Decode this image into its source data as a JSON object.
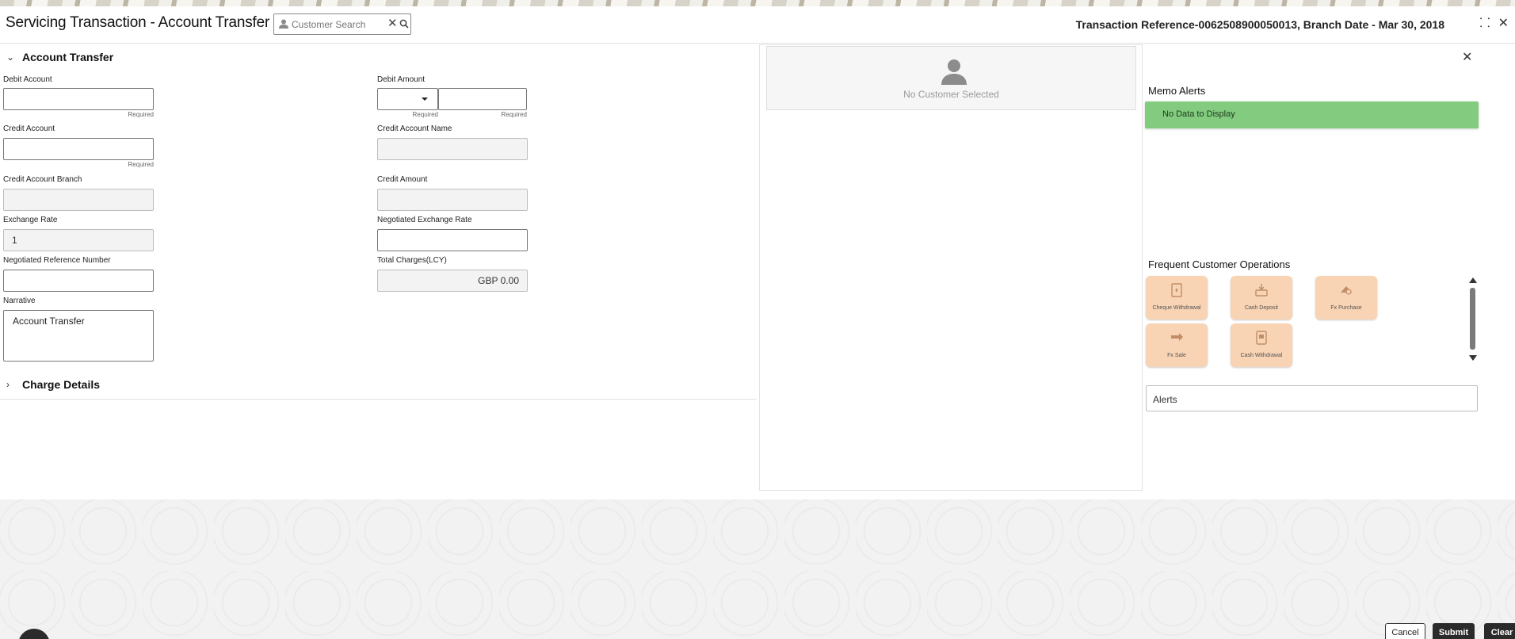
{
  "header": {
    "title": "Servicing Transaction - Account Transfer",
    "search_placeholder": "Customer Search",
    "transaction_reference": "Transaction Reference-0062508900050013, Branch Date - Mar 30, 2018",
    "icons": [
      "collapse-icon",
      "close-icon"
    ]
  },
  "form": {
    "section_title": "Account Transfer",
    "required_text": "Required",
    "debit_account": {
      "label": "Debit Account",
      "value": ""
    },
    "debit_amount": {
      "label": "Debit Amount",
      "currency": "",
      "value": ""
    },
    "credit_account": {
      "label": "Credit Account",
      "value": ""
    },
    "credit_account_name": {
      "label": "Credit Account Name",
      "value": ""
    },
    "credit_account_branch": {
      "label": "Credit Account Branch",
      "value": ""
    },
    "credit_amount": {
      "label": "Credit Amount",
      "value": ""
    },
    "exchange_rate": {
      "label": "Exchange Rate",
      "value": "1"
    },
    "negotiated_exchange_rate": {
      "label": "Negotiated Exchange Rate",
      "value": ""
    },
    "negotiated_reference_number": {
      "label": "Negotiated Reference Number",
      "value": ""
    },
    "total_charges": {
      "label": "Total Charges(LCY)",
      "value": "GBP 0.00"
    },
    "narrative": {
      "label": "Narrative",
      "value": "Account Transfer"
    },
    "charge_details_title": "Charge Details"
  },
  "customer_panel": {
    "empty_text": "No Customer Selected"
  },
  "right_panel": {
    "memo_alerts_title": "Memo Alerts",
    "memo_alerts_empty": "No Data to Display",
    "frequent_ops_title": "Frequent Customer Operations",
    "operations": [
      {
        "label": "Cheque Withdrawal",
        "icon": "cheque-icon"
      },
      {
        "label": "Cash Deposit",
        "icon": "cash-deposit-icon"
      },
      {
        "label": "Fx Purchase",
        "icon": "fx-purchase-icon"
      },
      {
        "label": "Fx Sale",
        "icon": "fx-sale-icon"
      },
      {
        "label": "Cash Withdrawal",
        "icon": "cash-withdrawal-icon"
      }
    ],
    "alerts_label": "Alerts"
  },
  "footer": {
    "cancel_label": "Cancel",
    "submit_label": "Submit",
    "clear_label": "Clear"
  },
  "colors": {
    "memo_bar": "#82cb7f",
    "op_tile": "#f8d3b4",
    "primary_button": "#2b2b2b"
  }
}
